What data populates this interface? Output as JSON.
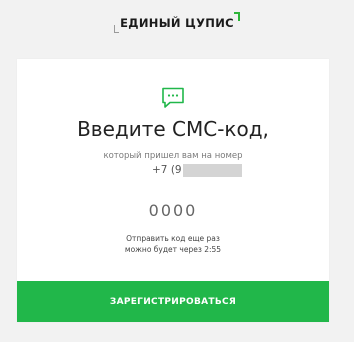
{
  "brand": {
    "logo_text": "ЕДИНЫЙ ЦУПИС",
    "accent_color": "#21b74a"
  },
  "card": {
    "icon": "sms-message-icon",
    "title": "Введите СМС-код,",
    "subtitle": "который пришел вам на номер",
    "phone_prefix": "+7 (9",
    "code_placeholder": "0000",
    "code_value": "",
    "resend_line1": "Отправить код еще раз",
    "resend_line2": "можно будет через 2:55",
    "submit_label": "ЗАРЕГИСТРИРОВАТЬСЯ"
  }
}
